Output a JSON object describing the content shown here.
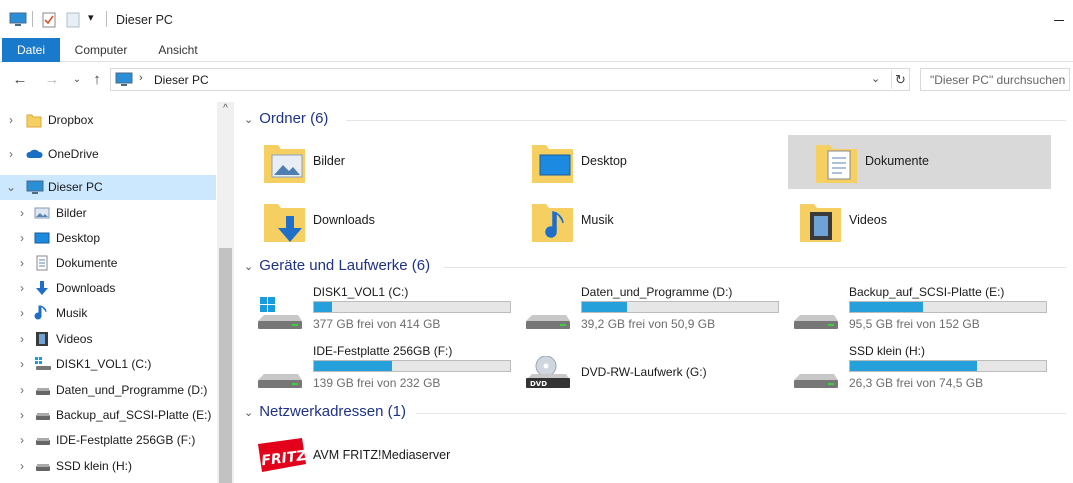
{
  "window": {
    "title": "Dieser PC"
  },
  "ribbon": {
    "tabs": [
      "Datei",
      "Computer",
      "Ansicht"
    ]
  },
  "nav": {
    "address_path": "Dieser PC",
    "search_placeholder": "\"Dieser PC\" durchsuchen"
  },
  "sidebar": {
    "items": [
      {
        "label": "Dropbox",
        "icon": "dropbox-folder-icon",
        "indent": 0
      },
      {
        "label": "OneDrive",
        "icon": "onedrive-cloud-icon",
        "indent": 0
      },
      {
        "label": "Dieser PC",
        "icon": "computer-icon",
        "indent": 0,
        "selected": true,
        "expanded": true
      },
      {
        "label": "Bilder",
        "icon": "pictures-folder-icon",
        "indent": 1
      },
      {
        "label": "Desktop",
        "icon": "desktop-folder-icon",
        "indent": 1
      },
      {
        "label": "Dokumente",
        "icon": "documents-folder-icon",
        "indent": 1
      },
      {
        "label": "Downloads",
        "icon": "downloads-arrow-icon",
        "indent": 1
      },
      {
        "label": "Musik",
        "icon": "music-note-icon",
        "indent": 1
      },
      {
        "label": "Videos",
        "icon": "videos-film-icon",
        "indent": 1
      },
      {
        "label": "DISK1_VOL1 (C:)",
        "icon": "windows-drive-icon",
        "indent": 1
      },
      {
        "label": "Daten_und_Programme (D:)",
        "icon": "hard-drive-icon",
        "indent": 1
      },
      {
        "label": "Backup_auf_SCSI-Platte (E:)",
        "icon": "hard-drive-icon",
        "indent": 1
      },
      {
        "label": "IDE-Festplatte 256GB (F:)",
        "icon": "hard-drive-icon",
        "indent": 1
      },
      {
        "label": "SSD klein (H:)",
        "icon": "hard-drive-icon",
        "indent": 1
      }
    ]
  },
  "groups": {
    "folders": {
      "title": "Ordner (6)",
      "items": [
        {
          "label": "Bilder",
          "icon": "pictures-folder-icon"
        },
        {
          "label": "Desktop",
          "icon": "desktop-folder-icon"
        },
        {
          "label": "Dokumente",
          "icon": "documents-folder-icon",
          "selected": true
        },
        {
          "label": "Downloads",
          "icon": "downloads-folder-icon"
        },
        {
          "label": "Musik",
          "icon": "music-folder-icon"
        },
        {
          "label": "Videos",
          "icon": "videos-folder-icon"
        }
      ]
    },
    "drives": {
      "title": "Geräte und Laufwerke (6)",
      "items": [
        {
          "name": "DISK1_VOL1 (C:)",
          "free": "377 GB frei von 414 GB",
          "used_fraction": 0.09,
          "icon": "windows-drive-icon"
        },
        {
          "name": "Daten_und_Programme (D:)",
          "free": "39,2 GB frei von 50,9 GB",
          "used_fraction": 0.23,
          "icon": "hard-drive-icon"
        },
        {
          "name": "Backup_auf_SCSI-Platte (E:)",
          "free": "95,5 GB frei von 152 GB",
          "used_fraction": 0.37,
          "icon": "hard-drive-icon"
        },
        {
          "name": "IDE-Festplatte 256GB (F:)",
          "free": "139 GB frei von 232 GB",
          "used_fraction": 0.4,
          "icon": "hard-drive-icon"
        },
        {
          "name": "DVD-RW-Laufwerk (G:)",
          "free": "",
          "icon": "dvd-drive-icon"
        },
        {
          "name": "SSD klein (H:)",
          "free": "26,3 GB frei von 74,5 GB",
          "used_fraction": 0.65,
          "icon": "hard-drive-icon"
        }
      ]
    },
    "network": {
      "title": "Netzwerkadressen (1)",
      "items": [
        {
          "label": "AVM FRITZ!Mediaserver",
          "icon": "fritz-logo-icon",
          "logo_text": "FRITZ!"
        }
      ]
    }
  },
  "colors": {
    "accent": "#1979ca",
    "selection": "#cce8ff",
    "progress": "#26a0da",
    "group_heading": "#1e3287"
  }
}
